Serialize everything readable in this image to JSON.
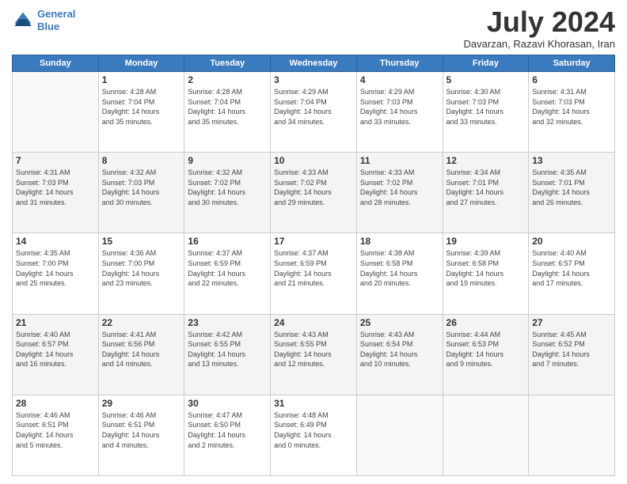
{
  "header": {
    "logo_line1": "General",
    "logo_line2": "Blue",
    "month_title": "July 2024",
    "subtitle": "Davarzan, Razavi Khorasan, Iran"
  },
  "days_of_week": [
    "Sunday",
    "Monday",
    "Tuesday",
    "Wednesday",
    "Thursday",
    "Friday",
    "Saturday"
  ],
  "weeks": [
    [
      {
        "day": "",
        "info": ""
      },
      {
        "day": "1",
        "info": "Sunrise: 4:28 AM\nSunset: 7:04 PM\nDaylight: 14 hours\nand 35 minutes."
      },
      {
        "day": "2",
        "info": "Sunrise: 4:28 AM\nSunset: 7:04 PM\nDaylight: 14 hours\nand 35 minutes."
      },
      {
        "day": "3",
        "info": "Sunrise: 4:29 AM\nSunset: 7:04 PM\nDaylight: 14 hours\nand 34 minutes."
      },
      {
        "day": "4",
        "info": "Sunrise: 4:29 AM\nSunset: 7:03 PM\nDaylight: 14 hours\nand 33 minutes."
      },
      {
        "day": "5",
        "info": "Sunrise: 4:30 AM\nSunset: 7:03 PM\nDaylight: 14 hours\nand 33 minutes."
      },
      {
        "day": "6",
        "info": "Sunrise: 4:31 AM\nSunset: 7:03 PM\nDaylight: 14 hours\nand 32 minutes."
      }
    ],
    [
      {
        "day": "7",
        "info": "Sunrise: 4:31 AM\nSunset: 7:03 PM\nDaylight: 14 hours\nand 31 minutes."
      },
      {
        "day": "8",
        "info": "Sunrise: 4:32 AM\nSunset: 7:03 PM\nDaylight: 14 hours\nand 30 minutes."
      },
      {
        "day": "9",
        "info": "Sunrise: 4:32 AM\nSunset: 7:02 PM\nDaylight: 14 hours\nand 30 minutes."
      },
      {
        "day": "10",
        "info": "Sunrise: 4:33 AM\nSunset: 7:02 PM\nDaylight: 14 hours\nand 29 minutes."
      },
      {
        "day": "11",
        "info": "Sunrise: 4:33 AM\nSunset: 7:02 PM\nDaylight: 14 hours\nand 28 minutes."
      },
      {
        "day": "12",
        "info": "Sunrise: 4:34 AM\nSunset: 7:01 PM\nDaylight: 14 hours\nand 27 minutes."
      },
      {
        "day": "13",
        "info": "Sunrise: 4:35 AM\nSunset: 7:01 PM\nDaylight: 14 hours\nand 26 minutes."
      }
    ],
    [
      {
        "day": "14",
        "info": "Sunrise: 4:35 AM\nSunset: 7:00 PM\nDaylight: 14 hours\nand 25 minutes."
      },
      {
        "day": "15",
        "info": "Sunrise: 4:36 AM\nSunset: 7:00 PM\nDaylight: 14 hours\nand 23 minutes."
      },
      {
        "day": "16",
        "info": "Sunrise: 4:37 AM\nSunset: 6:59 PM\nDaylight: 14 hours\nand 22 minutes."
      },
      {
        "day": "17",
        "info": "Sunrise: 4:37 AM\nSunset: 6:59 PM\nDaylight: 14 hours\nand 21 minutes."
      },
      {
        "day": "18",
        "info": "Sunrise: 4:38 AM\nSunset: 6:58 PM\nDaylight: 14 hours\nand 20 minutes."
      },
      {
        "day": "19",
        "info": "Sunrise: 4:39 AM\nSunset: 6:58 PM\nDaylight: 14 hours\nand 19 minutes."
      },
      {
        "day": "20",
        "info": "Sunrise: 4:40 AM\nSunset: 6:57 PM\nDaylight: 14 hours\nand 17 minutes."
      }
    ],
    [
      {
        "day": "21",
        "info": "Sunrise: 4:40 AM\nSunset: 6:57 PM\nDaylight: 14 hours\nand 16 minutes."
      },
      {
        "day": "22",
        "info": "Sunrise: 4:41 AM\nSunset: 6:56 PM\nDaylight: 14 hours\nand 14 minutes."
      },
      {
        "day": "23",
        "info": "Sunrise: 4:42 AM\nSunset: 6:55 PM\nDaylight: 14 hours\nand 13 minutes."
      },
      {
        "day": "24",
        "info": "Sunrise: 4:43 AM\nSunset: 6:55 PM\nDaylight: 14 hours\nand 12 minutes."
      },
      {
        "day": "25",
        "info": "Sunrise: 4:43 AM\nSunset: 6:54 PM\nDaylight: 14 hours\nand 10 minutes."
      },
      {
        "day": "26",
        "info": "Sunrise: 4:44 AM\nSunset: 6:53 PM\nDaylight: 14 hours\nand 9 minutes."
      },
      {
        "day": "27",
        "info": "Sunrise: 4:45 AM\nSunset: 6:52 PM\nDaylight: 14 hours\nand 7 minutes."
      }
    ],
    [
      {
        "day": "28",
        "info": "Sunrise: 4:46 AM\nSunset: 6:51 PM\nDaylight: 14 hours\nand 5 minutes."
      },
      {
        "day": "29",
        "info": "Sunrise: 4:46 AM\nSunset: 6:51 PM\nDaylight: 14 hours\nand 4 minutes."
      },
      {
        "day": "30",
        "info": "Sunrise: 4:47 AM\nSunset: 6:50 PM\nDaylight: 14 hours\nand 2 minutes."
      },
      {
        "day": "31",
        "info": "Sunrise: 4:48 AM\nSunset: 6:49 PM\nDaylight: 14 hours\nand 0 minutes."
      },
      {
        "day": "",
        "info": ""
      },
      {
        "day": "",
        "info": ""
      },
      {
        "day": "",
        "info": ""
      }
    ]
  ]
}
